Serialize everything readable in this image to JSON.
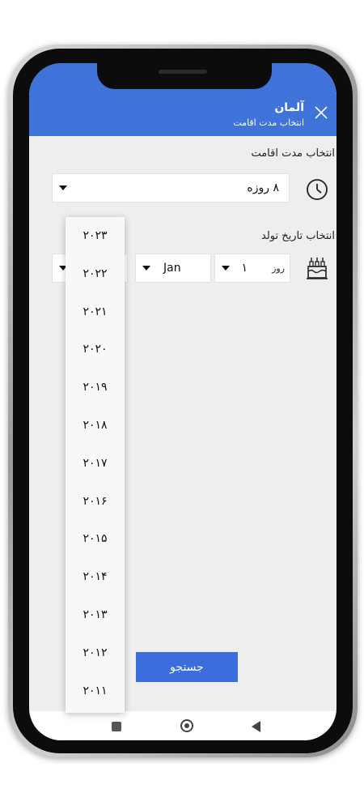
{
  "header": {
    "title": "آلمان",
    "subtitle": "انتخاب مدت اقامت"
  },
  "stay": {
    "label": "انتخاب مدت اقامت",
    "selected": "۸ روزه"
  },
  "birth": {
    "label": "انتخاب تاریخ تولد",
    "day_hint": "روز",
    "day_value": "۱",
    "month_value": "Jan",
    "year_options": [
      "۲۰۲۳",
      "۲۰۲۲",
      "۲۰۲۱",
      "۲۰۲۰",
      "۲۰۱۹",
      "۲۰۱۸",
      "۲۰۱۷",
      "۲۰۱۶",
      "۲۰۱۵",
      "۲۰۱۴",
      "۲۰۱۳",
      "۲۰۱۲",
      "۲۰۱۱"
    ]
  },
  "search_button": "جستجو",
  "colors": {
    "header": "#3f73d9",
    "button": "#3b6ddc",
    "background": "#eeeeee"
  },
  "icons": [
    "close-icon",
    "clock-icon",
    "birthday-cake-icon",
    "caret-down-icon",
    "nav-recent-icon",
    "nav-home-icon",
    "nav-back-icon"
  ]
}
